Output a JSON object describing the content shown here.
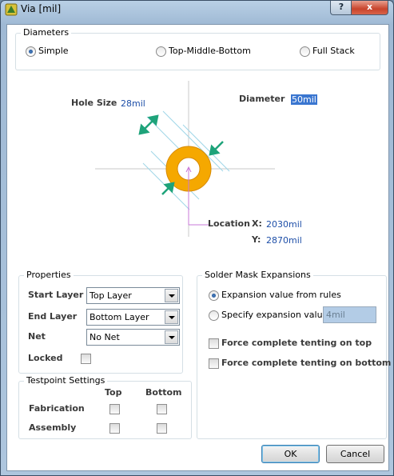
{
  "window": {
    "title": "Via [mil]",
    "help_label": "?",
    "close_label": "x"
  },
  "diameters": {
    "title": "Diameters",
    "options": [
      {
        "label": "Simple",
        "checked": true
      },
      {
        "label": "Top-Middle-Bottom",
        "checked": false
      },
      {
        "label": "Full Stack",
        "checked": false
      }
    ]
  },
  "diagram": {
    "hole_size_label": "Hole Size",
    "hole_size_value": "28mil",
    "diameter_label": "Diameter",
    "diameter_value": "50mil",
    "location_label": "Location",
    "x_label": "X:",
    "x_value": "2030mil",
    "y_label": "Y:",
    "y_value": "2870mil",
    "ring_color": "#f5a800",
    "arrow_color": "#1ea37a"
  },
  "properties": {
    "title": "Properties",
    "start_layer_label": "Start Layer",
    "start_layer_value": "Top Layer",
    "end_layer_label": "End Layer",
    "end_layer_value": "Bottom Layer",
    "net_label": "Net",
    "net_value": "No Net",
    "locked_label": "Locked",
    "locked_checked": false
  },
  "testpoint": {
    "title": "Testpoint Settings",
    "col_top": "Top",
    "col_bottom": "Bottom",
    "rows": [
      {
        "label": "Fabrication",
        "top": false,
        "bottom": false
      },
      {
        "label": "Assembly",
        "top": false,
        "bottom": false
      }
    ]
  },
  "solder_mask": {
    "title": "Solder Mask Expansions",
    "option_rules": "Expansion value from rules",
    "option_specify": "Specify expansion value",
    "specify_value": "4mil",
    "force_top": "Force complete tenting on top",
    "force_bottom": "Force complete tenting on bottom"
  },
  "buttons": {
    "ok": "OK",
    "cancel": "Cancel"
  }
}
